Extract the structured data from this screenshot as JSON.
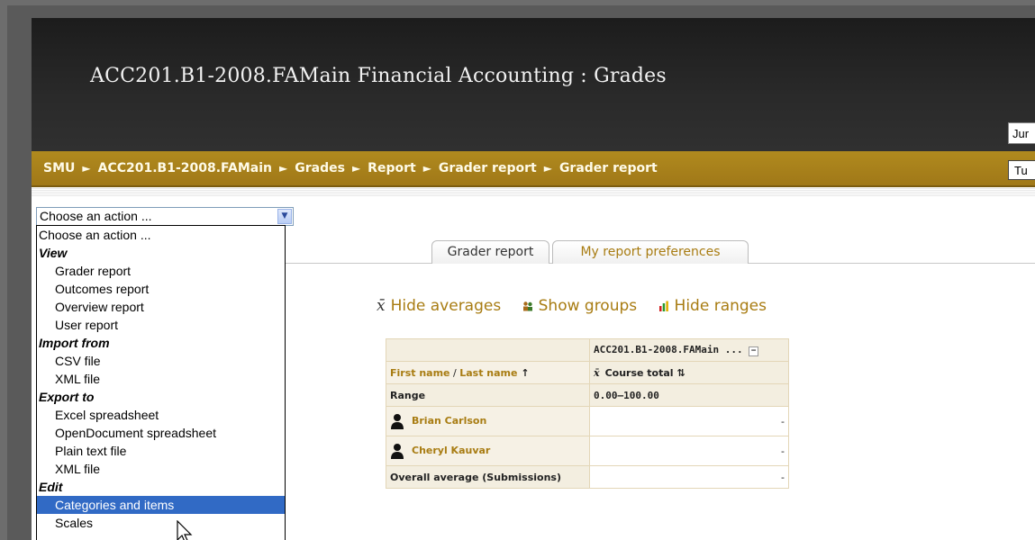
{
  "header": {
    "title": "ACC201.B1-2008.FAMain Financial Accounting : Grades",
    "jump_text": "Jur"
  },
  "navbar": {
    "crumbs": [
      "SMU",
      "ACC201.B1-2008.FAMain",
      "Grades",
      "Report",
      "Grader report",
      "Grader report"
    ],
    "separator": "►",
    "turn_editing_text": "Tu"
  },
  "action_select": {
    "value": "Choose an action ...",
    "options": [
      {
        "kind": "opt0",
        "label": "Choose an action ..."
      },
      {
        "kind": "group",
        "label": "View"
      },
      {
        "kind": "opt",
        "label": "Grader report"
      },
      {
        "kind": "opt",
        "label": "Outcomes report"
      },
      {
        "kind": "opt",
        "label": "Overview report"
      },
      {
        "kind": "opt",
        "label": "User report"
      },
      {
        "kind": "group",
        "label": "Import from"
      },
      {
        "kind": "opt",
        "label": "CSV file"
      },
      {
        "kind": "opt",
        "label": "XML file"
      },
      {
        "kind": "group",
        "label": "Export to"
      },
      {
        "kind": "opt",
        "label": "Excel spreadsheet"
      },
      {
        "kind": "opt",
        "label": "OpenDocument spreadsheet"
      },
      {
        "kind": "opt",
        "label": "Plain text file"
      },
      {
        "kind": "opt",
        "label": "XML file"
      },
      {
        "kind": "group",
        "label": "Edit"
      },
      {
        "kind": "opt",
        "label": "Categories and items",
        "selected": true
      },
      {
        "kind": "opt",
        "label": "Scales"
      }
    ]
  },
  "tabs": {
    "grader": "Grader report",
    "prefs": "My report preferences"
  },
  "actions": {
    "hide_averages": "Hide averages",
    "show_groups": "Show groups",
    "hide_ranges": "Hide ranges"
  },
  "grid": {
    "course_header": "ACC201.B1-2008.FAMain ...",
    "first_name": "First name",
    "name_sep": " / ",
    "last_name": "Last name",
    "sort_up": "↑",
    "course_total": "Course total",
    "sort_both": "⇅",
    "range_label": "Range",
    "range_value": "0.00–100.00",
    "students": [
      {
        "name": "Brian Carlson",
        "total": "-"
      },
      {
        "name": "Cheryl Kauvar",
        "total": "-"
      }
    ],
    "overall_label": "Overall average (Submissions)",
    "overall_value": "-"
  },
  "colors": {
    "navbar": "#a87c12",
    "link": "#a87c12",
    "selection": "#316ac5"
  },
  "icons": {
    "averages": "x-bar-icon",
    "groups": "groups-icon",
    "ranges": "bar-chart-icon"
  }
}
